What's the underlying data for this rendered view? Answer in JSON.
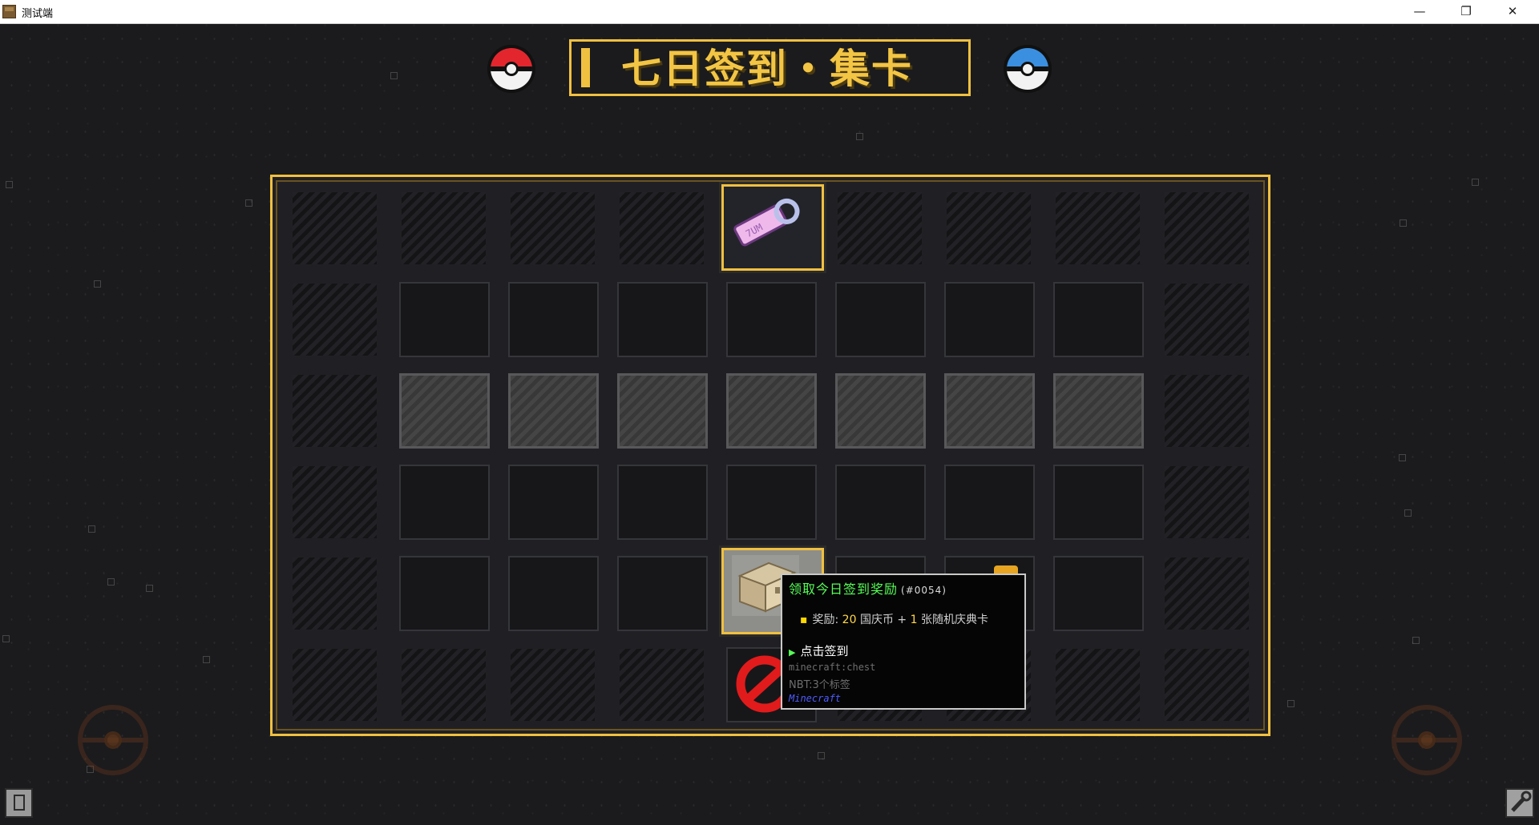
{
  "window": {
    "title": "测试端",
    "minimize_glyph": "—",
    "maximize_glyph": "❐",
    "close_glyph": "✕"
  },
  "heading": {
    "title": "七日签到・集卡",
    "left_icon": "pokeball-red-icon",
    "right_icon": "pokeball-blue-icon"
  },
  "inventory": {
    "rows": 6,
    "cols": 9,
    "featured_items": [
      {
        "name": "tag-icon",
        "row": 1,
        "col": 5
      },
      {
        "name": "chest-icon",
        "row": 5,
        "col": 5
      },
      {
        "name": "barrier-icon",
        "row": 6,
        "col": 5
      },
      {
        "name": "gold-coin-icon",
        "row": 5,
        "col": 7
      }
    ]
  },
  "tooltip": {
    "title": "领取今日签到奖励",
    "id": "(#0054)",
    "reward_label": "奖励:",
    "reward_amount": "20",
    "reward_currency": "国庆币",
    "reward_plus": "+",
    "reward_count": "1",
    "reward_card": "张随机庆典卡",
    "action": "点击签到",
    "item_id": "minecraft:chest",
    "nbt": "NBT:3个标签",
    "mod": "Minecraft"
  },
  "colors": {
    "accent_gold": "#f0c040",
    "tooltip_green": "#55ff55",
    "tooltip_mod_blue": "#4e5cff",
    "background": "#1b1b1d"
  },
  "corner_icons": {
    "bottom_left": "bookmark-icon",
    "bottom_right": "wrench-icon"
  }
}
